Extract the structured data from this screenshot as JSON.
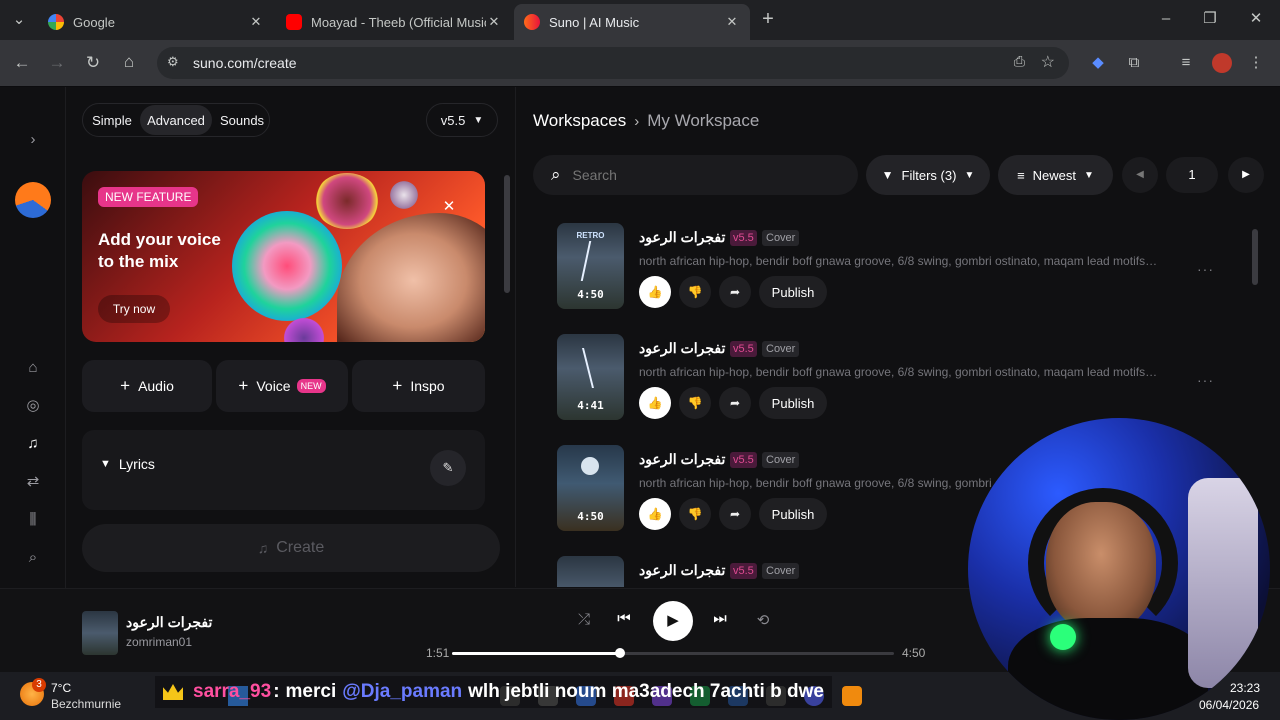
{
  "browser": {
    "tabs": [
      {
        "title": "Google",
        "active": false
      },
      {
        "title": "Moayad - Theeb (Official Music",
        "active": false
      },
      {
        "title": "Suno | AI Music",
        "active": true
      }
    ],
    "url": "suno.com/create"
  },
  "create_panel": {
    "modes": [
      "Simple",
      "Advanced",
      "Sounds"
    ],
    "active_mode": "Advanced",
    "version": "v5.5",
    "promo": {
      "badge": "NEW FEATURE",
      "headline_1": "Add your voice",
      "headline_2": "to the mix",
      "cta": "Try now"
    },
    "add_buttons": [
      {
        "label": "Audio"
      },
      {
        "label": "Voice",
        "badge": "NEW"
      },
      {
        "label": "Inspo"
      }
    ],
    "lyrics_label": "Lyrics",
    "create_label": "Create"
  },
  "workspace": {
    "breadcrumb_root": "Workspaces",
    "breadcrumb_current": "My Workspace",
    "search_placeholder": "Search",
    "filters_label": "Filters (3)",
    "sort_label": "Newest",
    "page": "1",
    "songs": [
      {
        "title": "تفجرات الرعود",
        "version": "v5.5",
        "type": "Cover",
        "description": "north african hip-hop, bendir boff gnawa groove, 6/8 swing, gombri ostinato, maqam lead motifs, darb...",
        "duration": "4:50",
        "art_label": "RETRO",
        "publish": "Publish"
      },
      {
        "title": "تفجرات الرعود",
        "version": "v5.5",
        "type": "Cover",
        "description": "north african hip-hop, bendir boff gnawa groove, 6/8 swing, gombri ostinato, maqam lead motifs, darb...",
        "duration": "4:41",
        "art_label": "",
        "publish": "Publish"
      },
      {
        "title": "تفجرات الرعود",
        "version": "v5.5",
        "type": "Cover",
        "description": "north african hip-hop, bendir boff gnawa groove, 6/8 swing, gombri ostinato, maqam lead motifs, darb...",
        "duration": "4:50",
        "art_label": "",
        "publish": "Publish"
      },
      {
        "title": "تفجرات الرعود",
        "version": "v5.5",
        "type": "Cover",
        "description": "",
        "duration": "",
        "art_label": "",
        "publish": ""
      }
    ]
  },
  "player": {
    "title": "تفجرات الرعود",
    "artist": "zomriman01",
    "elapsed": "1:51",
    "total": "4:50",
    "progress": 0.38
  },
  "taskbar": {
    "weather_temp": "7°C",
    "weather_place": "Bezchmurnie",
    "weather_badge": "3",
    "time": "23:23",
    "date": "06/04/2026"
  },
  "stream_overlay": {
    "chat_user": "sarra_93",
    "chat_sep": ":",
    "chat_msg_pre": "merci",
    "chat_mention": "@Dja_paman",
    "chat_msg_post": "wlh jebtli noum ma3adech 7achti b dwe"
  },
  "colors": {
    "accent_pink": "#e24a8d",
    "chat_user": "#ff4fa0",
    "chat_mention": "#6a7bff",
    "chat_text": "#ffffff"
  }
}
